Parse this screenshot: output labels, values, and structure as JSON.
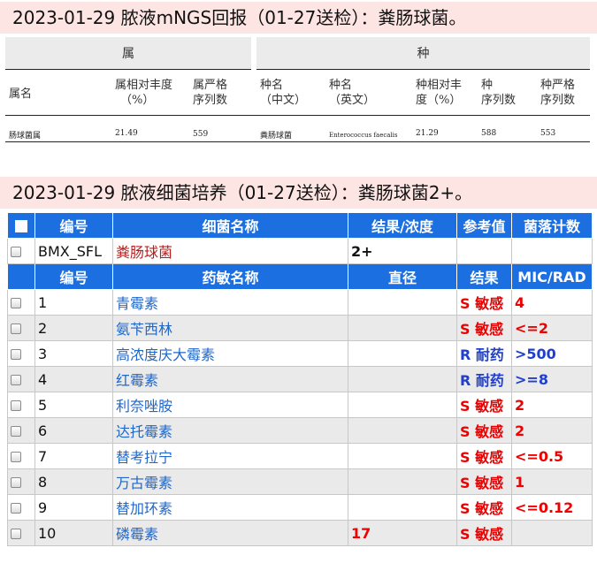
{
  "mngs": {
    "title": "2023-01-29 脓液mNGS回报（01-27送检）：粪肠球菌。",
    "genus_group": "属",
    "species_group": "种",
    "headers": {
      "genus_name": "属名",
      "genus_abund_1": "属相对丰度",
      "genus_abund_2": "（%）",
      "genus_reads_1": "属严格",
      "genus_reads_2": "序列数",
      "species_cn_1": "种名",
      "species_cn_2": "（中文）",
      "species_en_1": "种名",
      "species_en_2": "（英文）",
      "species_abund_1": "种相对丰",
      "species_abund_2": "度（%）",
      "species_count_1": "种",
      "species_count_2": "序列数",
      "species_reads_1": "种严格",
      "species_reads_2": "序列数"
    },
    "row": {
      "genus": "肠球菌属",
      "genus_abundance": "21.49",
      "genus_reads": "559",
      "species_cn": "粪肠球菌",
      "species_en": "Enterococcus faecalis",
      "species_abundance": "21.29",
      "species_count": "588",
      "species_reads": "553"
    }
  },
  "culture": {
    "title": "2023-01-29 脓液细菌培养（01-27送检）：粪肠球菌2+。",
    "headers": {
      "id": "编号",
      "bacteria_name": "细菌名称",
      "result_conc": "结果/浓度",
      "reference": "参考值",
      "colony_count": "菌落计数"
    },
    "bacteria_row": {
      "id": "BMX_SFL",
      "name": "粪肠球菌",
      "conc": "2+"
    },
    "drug_headers": {
      "id": "编号",
      "drug_name": "药敏名称",
      "diameter": "直径",
      "result": "结果",
      "mic": "MIC/RAD"
    },
    "drugs": [
      {
        "id": "1",
        "name": "青霉素",
        "diameter": "",
        "result": "S 敏感",
        "mic": "4",
        "type": "S"
      },
      {
        "id": "2",
        "name": "氨苄西林",
        "diameter": "",
        "result": "S 敏感",
        "mic": "<=2",
        "type": "S"
      },
      {
        "id": "3",
        "name": "高浓度庆大霉素",
        "diameter": "",
        "result": "R 耐药",
        "mic": ">500",
        "type": "R"
      },
      {
        "id": "4",
        "name": "红霉素",
        "diameter": "",
        "result": "R 耐药",
        "mic": ">=8",
        "type": "R"
      },
      {
        "id": "5",
        "name": "利奈唑胺",
        "diameter": "",
        "result": "S 敏感",
        "mic": "2",
        "type": "S"
      },
      {
        "id": "6",
        "name": "达托霉素",
        "diameter": "",
        "result": "S 敏感",
        "mic": "2",
        "type": "S"
      },
      {
        "id": "7",
        "name": "替考拉宁",
        "diameter": "",
        "result": "S 敏感",
        "mic": "<=0.5",
        "type": "S"
      },
      {
        "id": "8",
        "name": "万古霉素",
        "diameter": "",
        "result": "S 敏感",
        "mic": "1",
        "type": "S"
      },
      {
        "id": "9",
        "name": "替加环素",
        "diameter": "",
        "result": "S 敏感",
        "mic": "<=0.12",
        "type": "S"
      },
      {
        "id": "10",
        "name": "磷霉素",
        "diameter": "17",
        "result": "S 敏感",
        "mic": "",
        "type": "S"
      }
    ],
    "colors": {
      "header_bg": "#1b6fe0",
      "susceptible": "#ee0000",
      "resistant": "#1f3fcc",
      "drug_link": "#1f67c8",
      "bacteria": "#b51e1e"
    }
  }
}
